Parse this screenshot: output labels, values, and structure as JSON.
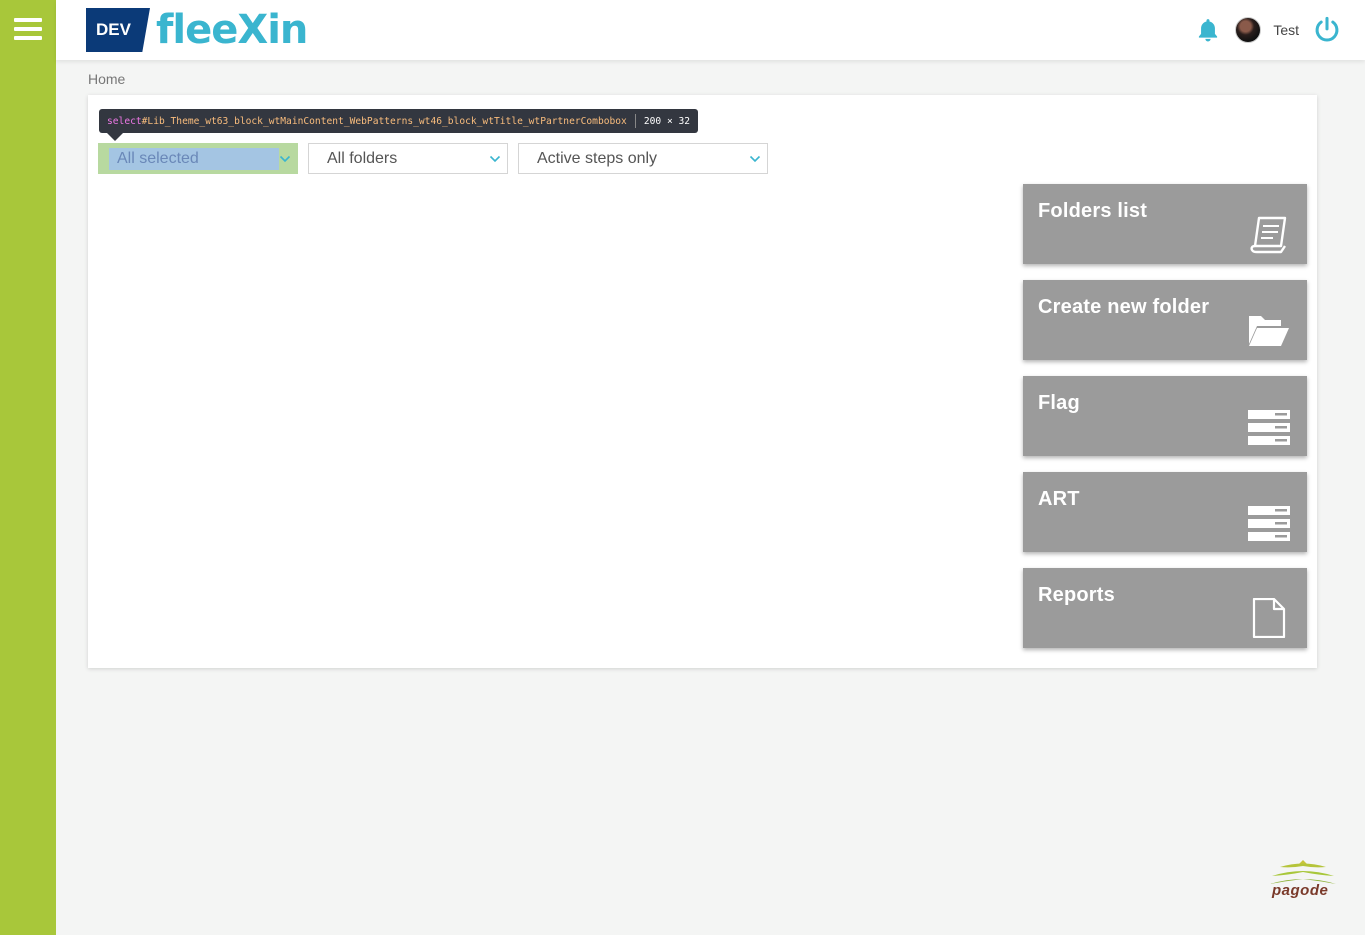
{
  "header": {
    "env_badge": "DEV",
    "brand": "fleeXin",
    "username": "Test"
  },
  "breadcrumb": {
    "label": "Home"
  },
  "inspector_tooltip": {
    "tag": "select",
    "selector": "#Lib_Theme_wt63_block_wtMainContent_WebPatterns_wt46_block_wtTitle_wtPartnerCombobox",
    "dims": "200 × 32"
  },
  "filters": {
    "partner": "All selected",
    "folders": "All folders",
    "steps": "Active steps only"
  },
  "tiles": [
    {
      "label": "Folders list",
      "icon": "book-icon"
    },
    {
      "label": "Create new folder",
      "icon": "folder-open-icon"
    },
    {
      "label": "Flag",
      "icon": "server-icon"
    },
    {
      "label": "ART",
      "icon": "server-icon"
    },
    {
      "label": "Reports",
      "icon": "document-icon"
    }
  ],
  "footer_logo": "pagode",
  "colors": {
    "sidebar": "#a8c73a",
    "brand": "#3ab5cf",
    "badge": "#0b3a78",
    "tile": "#9b9b9b"
  }
}
